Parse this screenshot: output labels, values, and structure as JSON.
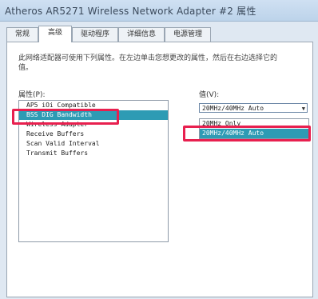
{
  "window": {
    "title": "Atheros AR5271 Wireless Network Adapter #2 属性"
  },
  "tabs": [
    {
      "label": "常规"
    },
    {
      "label": "高级"
    },
    {
      "label": "驱动程序"
    },
    {
      "label": "详细信息"
    },
    {
      "label": "电源管理"
    }
  ],
  "active_tab": "高级",
  "advanced": {
    "description": "此网络适配器可使用下列属性。在左边单击您想更改的属性，然后在右边选择它的值。",
    "property_label": "属性(P):",
    "value_label": "值(V):",
    "properties": [
      "AP5 iOi Compatible",
      "BSS DIG Bandwidth",
      "Wireless Adapter",
      "Receive Buffers",
      "Scan Valid Interval",
      "Transmit Buffers"
    ],
    "selected_property_index": 1,
    "value_combo": "20MHz/40MHz Auto",
    "value_options": [
      "20MHz Only",
      "20MHz/40MHz Auto"
    ],
    "selected_option_index": 1,
    "highlight_color": "#e8204f",
    "selection_color": "#2e9bb4"
  }
}
